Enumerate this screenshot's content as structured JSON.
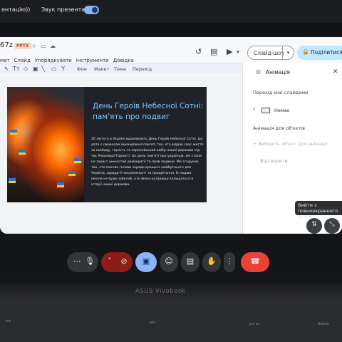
{
  "meet_bar": {
    "left_text": "ентацію))",
    "sound_label": "Звук презентації",
    "sound_toggle_on": true
  },
  "document": {
    "title_fragment": "67z",
    "file_badge": "PPTX",
    "menu": [
      "мат",
      "Слайд",
      "Упорядкувати",
      "Інструменти",
      "Довідка"
    ]
  },
  "header_actions": {
    "slideshow_label": "Слайд-шоу",
    "share_label": "Поділитися"
  },
  "toolbar": {
    "items": [
      "Фон",
      "Макет",
      "Тема",
      "Перехід"
    ]
  },
  "slide": {
    "title": "День Героїв Небесної Сотні: пам'ять про подвиг",
    "body": "20 лютого в Україні вшановують День Героїв Небесної Сотні. Ця дата є символом вшанування пам'яті тих, хто віддав своє життя за свободу, гідність та європейський вибір нашої держави під час Революції Гідності. Це день пам'яті про українців, які стали на захист цінностей демократії та прав людини. Ми згадуємо тих, хто поклав голови заради кращого майбутнього для України, заради її незалежності та процвітання. Їх подвиг ніколи не буде забутий, а їх імена назавжди залишаться в історії нашої держави."
  },
  "animation_panel": {
    "title": "Анімація",
    "transition_section": "Перехід між слайдами",
    "transition_value": "Немає",
    "object_section": "Анімація для об'єктів",
    "select_object": "+ Виберіть об'єкт для анімації",
    "cancel": "Відтворити"
  },
  "tooltip": {
    "text": "Вийти з повноекранного режиму"
  },
  "laptop": {
    "brand": "ASUS Vivobook",
    "keys": [
      "ins",
      "pm",
      "prt sc",
      "delete"
    ]
  },
  "icons": {
    "hangup": "phone-hangup-icon",
    "mic": "mic-icon",
    "cam_off": "camera-off-icon",
    "present": "present-icon",
    "emoji": "emoji-icon",
    "captions": "captions-icon",
    "hand": "raise-hand-icon",
    "more": "more-vert-icon"
  },
  "colors": {
    "hangup_red": "#ea4335",
    "present_blue": "#8ab4f8",
    "cam_red": "#8c1d18",
    "slide_title": "#7ec8ff",
    "share_bg": "#c2e7ff"
  }
}
